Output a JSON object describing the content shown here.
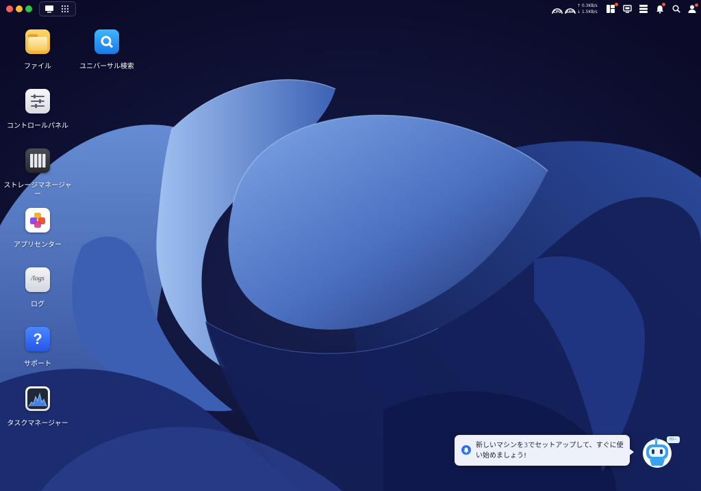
{
  "window": {
    "controls": [
      "close",
      "minimize",
      "zoom"
    ],
    "view_switch": [
      "desktop-icon",
      "app-grid-icon"
    ]
  },
  "tray": {
    "cpu_label": "CPU",
    "ram_label": "RAM",
    "upload": "↑ 0.3KB/s",
    "download": "↓ 1.5KB/s",
    "icons": [
      "widgets-icon",
      "monitor-icon",
      "server-icon",
      "bell-icon",
      "search-icon",
      "user-icon"
    ],
    "badges": [
      "widgets",
      "bell",
      "user"
    ]
  },
  "desktop": {
    "icons": [
      {
        "label": "ファイル",
        "icon": "folder-icon"
      },
      {
        "label": "ユニバーサル検索",
        "icon": "universal-search-icon"
      },
      {
        "label": "コントロールパネル",
        "icon": "control-panel-icon"
      },
      {
        "label": "ストレージマネージャー",
        "icon": "storage-manager-icon"
      },
      {
        "label": "アプリセンター",
        "icon": "app-center-icon"
      },
      {
        "label": "ログ",
        "icon": "logs-icon",
        "tile_text": "/logs"
      },
      {
        "label": "サポート",
        "icon": "support-icon",
        "tile_text": "?"
      },
      {
        "label": "タスクマネージャー",
        "icon": "task-manager-icon"
      }
    ]
  },
  "notification": {
    "text_part1": "新しいマシンを",
    "highlight": "3",
    "text_part2": "でセットアップして、すぐに使い始めましょう!",
    "assistant_greeting": "Hi~",
    "colors": {
      "highlight": "#2f6ff0",
      "background": "#eef1fa"
    }
  },
  "colors": {
    "background": "#0d0a2e",
    "wallpaper_light": "#5f8ad6",
    "wallpaper_dark": "#1a2a66"
  }
}
